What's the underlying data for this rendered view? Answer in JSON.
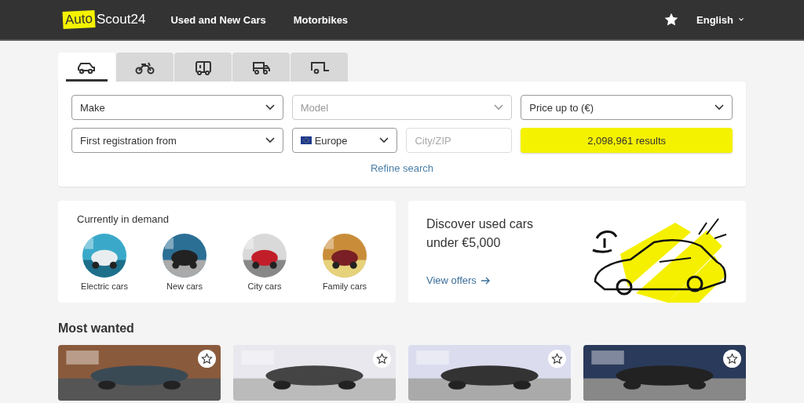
{
  "header": {
    "logo": {
      "highlight": "Auto",
      "rest": "Scout24"
    },
    "nav": [
      "Used and New Cars",
      "Motorbikes"
    ],
    "language": "English"
  },
  "vehicle_tabs": [
    {
      "kind": "car",
      "selected": true
    },
    {
      "kind": "motorbike",
      "selected": false
    },
    {
      "kind": "camper",
      "selected": false
    },
    {
      "kind": "truck",
      "selected": false
    },
    {
      "kind": "trailer",
      "selected": false
    }
  ],
  "search": {
    "filters": [
      {
        "kind": "select",
        "label": "Make",
        "disabled": false
      },
      {
        "kind": "select",
        "label": "Model",
        "disabled": true
      },
      {
        "kind": "select",
        "label": "Price up to (€)",
        "disabled": false
      },
      {
        "kind": "select",
        "label": "First registration from",
        "disabled": false
      },
      {
        "kind": "country",
        "label": "Europe"
      },
      {
        "kind": "input",
        "placeholder": "City/ZIP"
      },
      {
        "kind": "button",
        "label": "2,098,961 results"
      }
    ],
    "refine_link": "Refine search"
  },
  "in_demand": {
    "title": "Currently in demand",
    "categories": [
      {
        "label": "Electric cars"
      },
      {
        "label": "New cars"
      },
      {
        "label": "City cars"
      },
      {
        "label": "Family cars"
      }
    ]
  },
  "promo": {
    "title": "Discover used cars under €5,000",
    "link": "View offers"
  },
  "most_wanted": {
    "title": "Most wanted"
  }
}
